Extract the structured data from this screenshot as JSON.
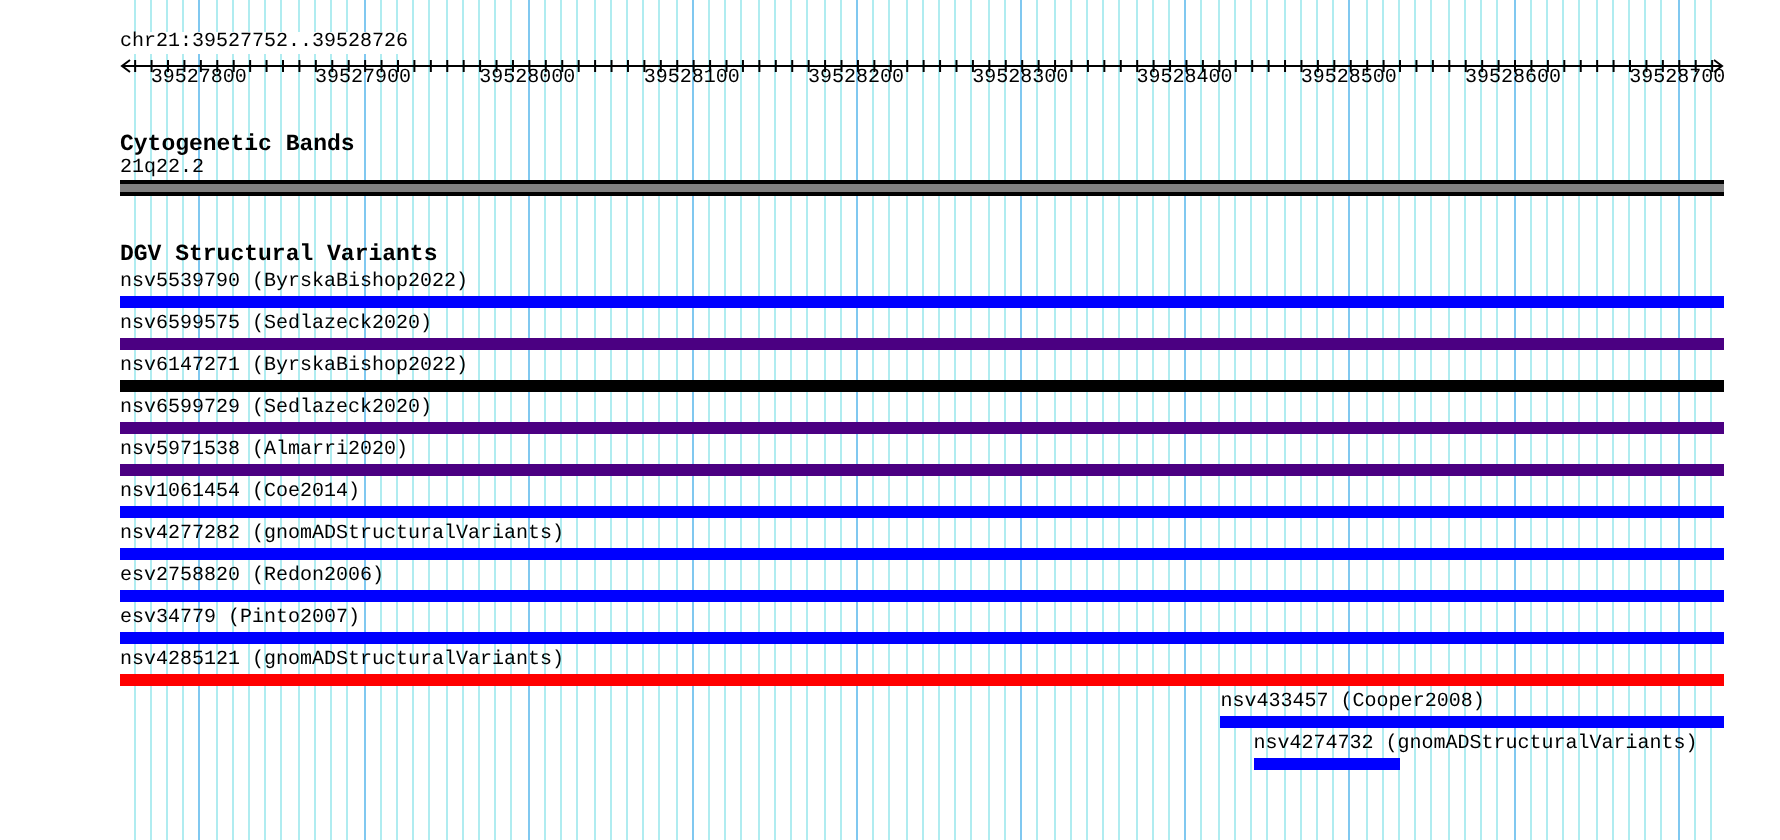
{
  "view": {
    "location": "chr21:39527752..39528726"
  },
  "ruler": {
    "ticks": [
      "39527800",
      "39527900",
      "39528000",
      "39528100",
      "39528200",
      "39528300",
      "39528400",
      "39528500",
      "39528600",
      "39528700"
    ]
  },
  "tracks": [
    {
      "kind": "band",
      "title": "Cytogenetic Bands",
      "features": [
        {
          "label": "21q22.2",
          "color": "#808080"
        }
      ]
    },
    {
      "kind": "variants",
      "title": "DGV Structural Variants",
      "features": [
        {
          "label": "nsv5539790 (ByrskaBishop2022)",
          "color": "#0000ff"
        },
        {
          "label": "nsv6599575 (Sedlazeck2020)",
          "color": "#4b0082"
        },
        {
          "label": "nsv6147271 (ByrskaBishop2022)",
          "color": "#000000"
        },
        {
          "label": "nsv6599729 (Sedlazeck2020)",
          "color": "#4b0082"
        },
        {
          "label": "nsv5971538 (Almarri2020)",
          "color": "#4b0082"
        },
        {
          "label": "nsv1061454 (Coe2014)",
          "color": "#0000ff"
        },
        {
          "label": "nsv4277282 (gnomADStructuralVariants)",
          "color": "#0000ff"
        },
        {
          "label": "esv2758820 (Redon2006)",
          "color": "#0000ff"
        },
        {
          "label": "esv34779 (Pinto2007)",
          "color": "#0000ff"
        },
        {
          "label": "nsv4285121 (gnomADStructuralVariants)",
          "color": "#ff0000"
        },
        {
          "label": "nsv433457 (Cooper2008)",
          "color": "#0000ff"
        },
        {
          "label": "nsv4274732 (gnomADStructuralVariants)",
          "color": "#0000ff"
        }
      ]
    }
  ]
}
